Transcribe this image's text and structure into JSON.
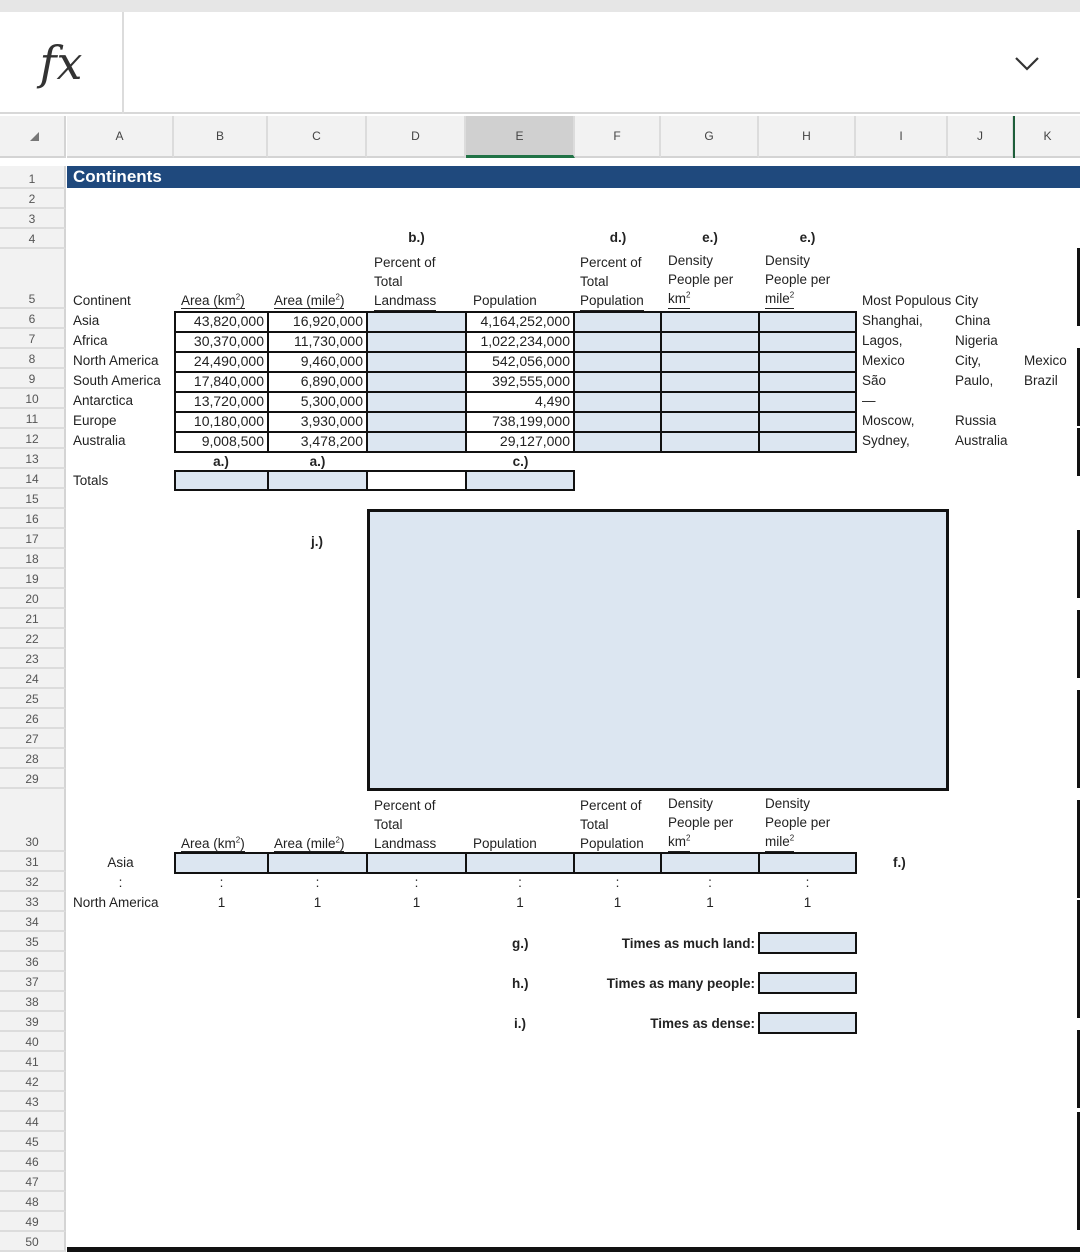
{
  "formula_bar": {
    "fx_label": "fx",
    "value": "",
    "expand_icon": "chevron-down-icon"
  },
  "columns": [
    "A",
    "B",
    "C",
    "D",
    "E",
    "F",
    "G",
    "H",
    "I",
    "J",
    "K"
  ],
  "selected_column": "E",
  "rows": [
    "1",
    "2",
    "3",
    "4",
    "5",
    "6",
    "7",
    "8",
    "9",
    "10",
    "11",
    "12",
    "13",
    "14",
    "15",
    "16",
    "17",
    "18",
    "19",
    "20",
    "21",
    "22",
    "23",
    "24",
    "25",
    "26",
    "27",
    "28",
    "29",
    "30",
    "31",
    "32",
    "33",
    "34",
    "35",
    "36",
    "37",
    "38",
    "39",
    "40",
    "41",
    "42",
    "43",
    "44",
    "45",
    "46",
    "47",
    "48",
    "49",
    "50"
  ],
  "sheet": {
    "title": "Continents",
    "part_labels": {
      "b": "b.)",
      "d": "d.)",
      "e1": "e.)",
      "e2": "e.)",
      "a1": "a.)",
      "a2": "a.)",
      "c": "c.)",
      "j": "j.)",
      "f": "f.)",
      "g": "g.)",
      "h": "h.)",
      "i": "i.)"
    },
    "headers": {
      "continent": "Continent",
      "area_km": "Area (km",
      "area_mile": "Area (mile",
      "sq": "2",
      "close_paren": ")",
      "pct_land_1": "Percent of",
      "pct_land_2": "Total",
      "pct_land_3": "Landmass",
      "population": "Population",
      "pct_pop_1": "Percent of",
      "pct_pop_2": "Total",
      "pct_pop_3": "Population",
      "dens_km_1": "Density",
      "dens_km_2": "People per",
      "dens_km_3": "km",
      "dens_mi_1": "Density",
      "dens_mi_2": "People per",
      "dens_mi_3": "mile",
      "city": "Most Populous City"
    },
    "table": [
      {
        "continent": "Asia",
        "area_km": "43,820,000",
        "area_mile": "16,920,000",
        "population": "4,164,252,000",
        "city_i": "Shanghai,",
        "city_j": "China",
        "city_k": ""
      },
      {
        "continent": "Africa",
        "area_km": "30,370,000",
        "area_mile": "11,730,000",
        "population": "1,022,234,000",
        "city_i": "Lagos,",
        "city_j": "Nigeria",
        "city_k": ""
      },
      {
        "continent": "North America",
        "area_km": "24,490,000",
        "area_mile": "9,460,000",
        "population": "542,056,000",
        "city_i": "Mexico",
        "city_j": "City,",
        "city_k": "Mexico"
      },
      {
        "continent": "South America",
        "area_km": "17,840,000",
        "area_mile": "6,890,000",
        "population": "392,555,000",
        "city_i": "São",
        "city_j": "Paulo,",
        "city_k": "Brazil"
      },
      {
        "continent": "Antarctica",
        "area_km": "13,720,000",
        "area_mile": "5,300,000",
        "population": "4,490",
        "city_i": "—",
        "city_j": "",
        "city_k": ""
      },
      {
        "continent": "Europe",
        "area_km": "10,180,000",
        "area_mile": "3,930,000",
        "population": "738,199,000",
        "city_i": "Moscow,",
        "city_j": "Russia",
        "city_k": ""
      },
      {
        "continent": "Australia",
        "area_km": "9,008,500",
        "area_mile": "3,478,200",
        "population": "29,127,000",
        "city_i": "Sydney,",
        "city_j": "Australia",
        "city_k": ""
      }
    ],
    "totals_label": "Totals",
    "ratio": {
      "row1_label": "Asia",
      "colon": ":",
      "row3_label": "North America",
      "one": "1"
    },
    "comparisons": {
      "land": "Times as much land:",
      "people": "Times as many people:",
      "dense": "Times as dense:"
    }
  },
  "colors": {
    "title_bar": "#1f497d",
    "input_fill": "#dce6f1",
    "selected_col_accent": "#217346"
  }
}
